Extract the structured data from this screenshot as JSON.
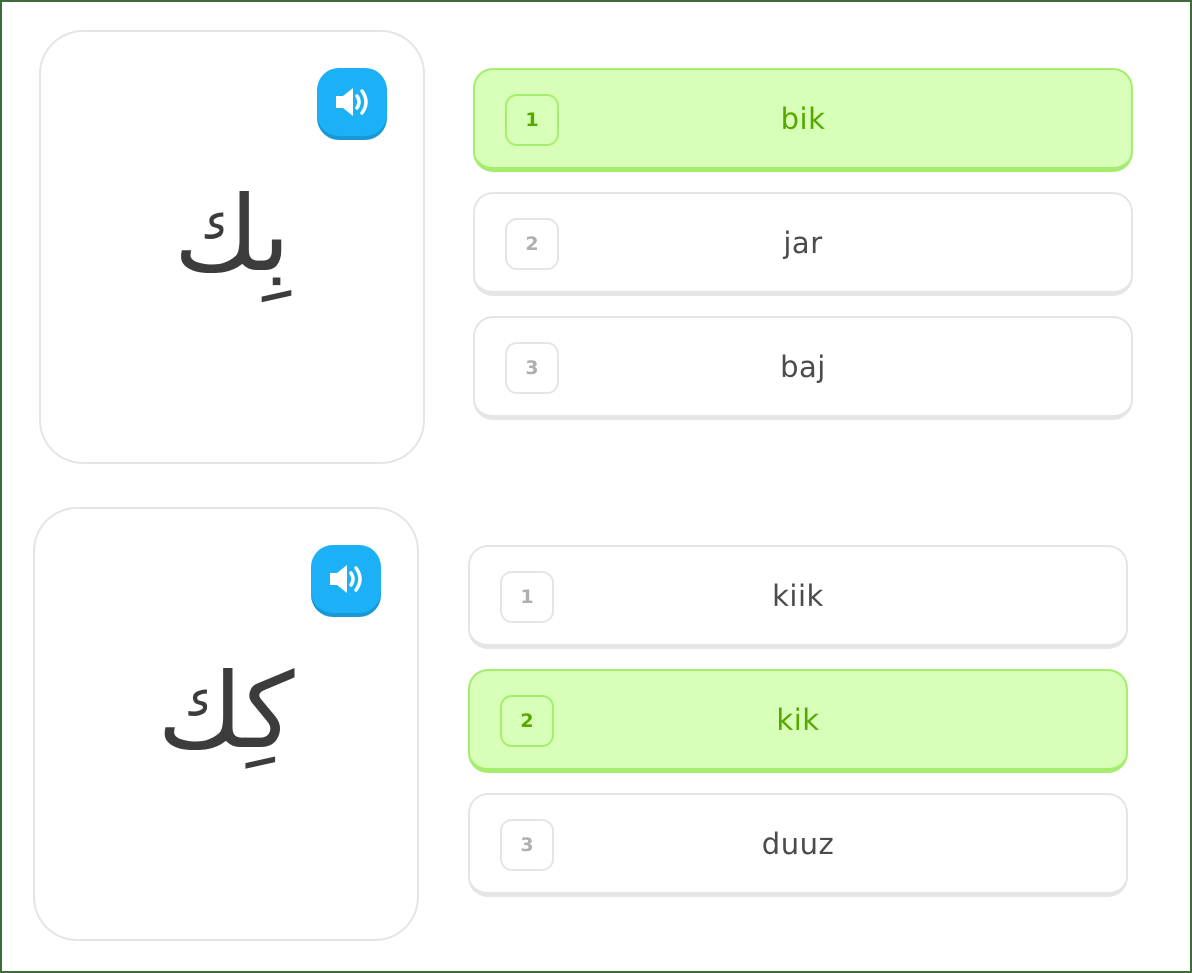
{
  "exercises": [
    {
      "character": "بِك",
      "speaker_icon": "speaker-icon",
      "options": [
        {
          "number": "1",
          "label": "bik",
          "selected": true
        },
        {
          "number": "2",
          "label": "jar",
          "selected": false
        },
        {
          "number": "3",
          "label": "baj",
          "selected": false
        }
      ]
    },
    {
      "character": "كِك",
      "speaker_icon": "speaker-icon",
      "options": [
        {
          "number": "1",
          "label": "kiik",
          "selected": false
        },
        {
          "number": "2",
          "label": "kik",
          "selected": true
        },
        {
          "number": "3",
          "label": "duuz",
          "selected": false
        }
      ]
    }
  ],
  "colors": {
    "frame_border": "#3f6b3a",
    "speaker_blue": "#1cb0f6",
    "selected_bg": "#d7ffb8",
    "selected_border": "#a5ed6e",
    "selected_text": "#58a700"
  }
}
